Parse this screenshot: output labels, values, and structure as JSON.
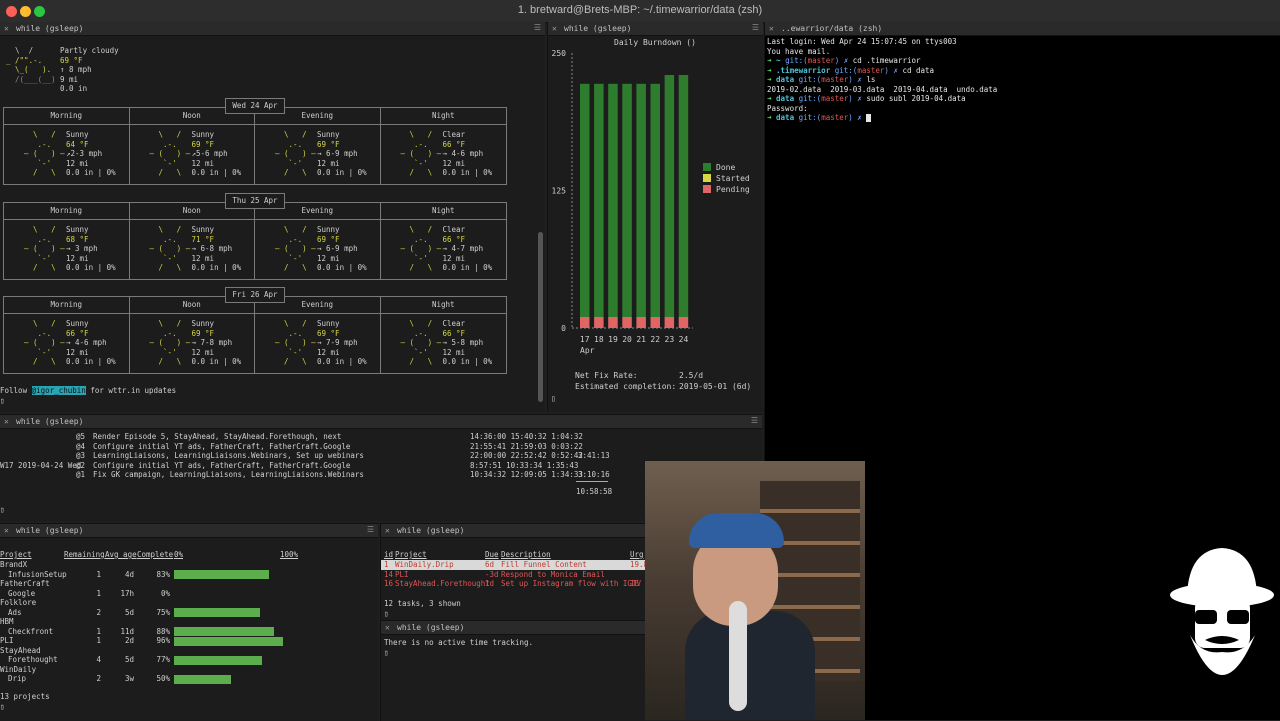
{
  "window": {
    "title": "1. bretward@Brets-MBP: ~/.timewarrior/data (zsh)"
  },
  "panes": {
    "weather": {
      "title": "while (gsleep)"
    },
    "burndown": {
      "title": "while (gsleep)"
    },
    "shell": {
      "title": "..ewarrior/data (zsh)"
    },
    "timew": {
      "title": "while (gsleep)"
    },
    "projects": {
      "title": "while (gsleep)"
    },
    "tasks": {
      "title": "while (gsleep)"
    },
    "tracking": {
      "title": "while (gsleep)"
    }
  },
  "weather": {
    "current": {
      "cond": "Partly cloudy",
      "temp": "69 °F",
      "wind": "↑ 8 mph",
      "vis": "9 mi",
      "precip": "0.0 in"
    },
    "periods": [
      "Morning",
      "Noon",
      "Evening",
      "Night"
    ],
    "days": [
      {
        "date": "Wed 24 Apr",
        "cells": [
          {
            "cond": "Sunny",
            "temp": "64 °F",
            "wind": "↗2-3 mph",
            "vis": "12 mi",
            "precip": "0.0 in | 0%"
          },
          {
            "cond": "Sunny",
            "temp": "69 °F",
            "wind": "↗5-6 mph",
            "vis": "12 mi",
            "precip": "0.0 in | 0%"
          },
          {
            "cond": "Sunny",
            "temp": "69 °F",
            "wind": "→ 6-9 mph",
            "vis": "12 mi",
            "precip": "0.0 in | 0%"
          },
          {
            "cond": "Clear",
            "temp": "66 °F",
            "wind": "→ 4-6 mph",
            "vis": "12 mi",
            "precip": "0.0 in | 0%"
          }
        ]
      },
      {
        "date": "Thu 25 Apr",
        "cells": [
          {
            "cond": "Sunny",
            "temp": "68 °F",
            "wind": "→ 3 mph",
            "vis": "12 mi",
            "precip": "0.0 in | 0%"
          },
          {
            "cond": "Sunny",
            "temp": "71 °F",
            "wind": "→ 6-8 mph",
            "vis": "12 mi",
            "precip": "0.0 in | 0%"
          },
          {
            "cond": "Sunny",
            "temp": "69 °F",
            "wind": "→ 6-9 mph",
            "vis": "12 mi",
            "precip": "0.0 in | 0%"
          },
          {
            "cond": "Clear",
            "temp": "66 °F",
            "wind": "→ 4-7 mph",
            "vis": "12 mi",
            "precip": "0.0 in | 0%"
          }
        ]
      },
      {
        "date": "Fri 26 Apr",
        "cells": [
          {
            "cond": "Sunny",
            "temp": "66 °F",
            "wind": "→ 4-6 mph",
            "vis": "12 mi",
            "precip": "0.0 in | 0%"
          },
          {
            "cond": "Sunny",
            "temp": "69 °F",
            "wind": "→ 7-8 mph",
            "vis": "12 mi",
            "precip": "0.0 in | 0%"
          },
          {
            "cond": "Sunny",
            "temp": "69 °F",
            "wind": "→ 7-9 mph",
            "vis": "12 mi",
            "precip": "0.0 in | 0%"
          },
          {
            "cond": "Clear",
            "temp": "66 °F",
            "wind": "→ 5-8 mph",
            "vis": "12 mi",
            "precip": "0.0 in | 0%"
          }
        ]
      }
    ],
    "follow": {
      "pre": "Follow",
      "handle": "@igor_chubin",
      "post": "for wttr.in updates"
    }
  },
  "burndown": {
    "title": "Daily Burndown ()",
    "y_ticks": [
      "250",
      "125",
      "0"
    ],
    "x_labels": [
      "17",
      "18",
      "19",
      "20",
      "21",
      "22",
      "23",
      "24"
    ],
    "x_month": "Apr",
    "legend": [
      {
        "label": "Done",
        "color": "#2e7d2e"
      },
      {
        "label": "Started",
        "color": "#d7d744"
      },
      {
        "label": "Pending",
        "color": "#e06666"
      }
    ],
    "net_fix_label": "Net Fix Rate:",
    "net_fix_value": "2.5/d",
    "est_label": "Estimated completion:",
    "est_value": "2019-05-01 (6d)"
  },
  "chart_data": {
    "type": "bar",
    "categories": [
      "17",
      "18",
      "19",
      "20",
      "21",
      "22",
      "23",
      "24"
    ],
    "series": [
      {
        "name": "Done",
        "values": [
          212,
          212,
          212,
          212,
          212,
          212,
          220,
          220
        ]
      },
      {
        "name": "Pending",
        "values": [
          10,
          10,
          10,
          10,
          10,
          10,
          10,
          10
        ]
      }
    ],
    "title": "Daily Burndown ()",
    "xlabel": "Apr",
    "ylabel": "",
    "ylim": [
      0,
      250
    ]
  },
  "shell": {
    "lines": [
      {
        "parts": [
          {
            "t": "Last login: Wed Apr 24 15:07:45 on ttys003",
            "c": "w"
          }
        ]
      },
      {
        "parts": [
          {
            "t": "You have mail.",
            "c": "w"
          }
        ]
      },
      {
        "parts": [
          {
            "t": "➜ ",
            "c": "g"
          },
          {
            "t": "~ ",
            "c": "cy"
          },
          {
            "t": "git:(",
            "c": "b"
          },
          {
            "t": "master",
            "c": "r"
          },
          {
            "t": ") ✗ ",
            "c": "b"
          },
          {
            "t": "cd .timewarrior",
            "c": "w"
          }
        ]
      },
      {
        "parts": [
          {
            "t": "➜ ",
            "c": "g"
          },
          {
            "t": ".timewarrior ",
            "c": "cy"
          },
          {
            "t": "git:(",
            "c": "b"
          },
          {
            "t": "master",
            "c": "r"
          },
          {
            "t": ") ✗ ",
            "c": "b"
          },
          {
            "t": "cd data",
            "c": "w"
          }
        ]
      },
      {
        "parts": [
          {
            "t": "➜ ",
            "c": "g"
          },
          {
            "t": "data ",
            "c": "cy"
          },
          {
            "t": "git:(",
            "c": "b"
          },
          {
            "t": "master",
            "c": "r"
          },
          {
            "t": ") ✗ ",
            "c": "b"
          },
          {
            "t": "ls",
            "c": "w"
          }
        ]
      },
      {
        "parts": [
          {
            "t": "2019-02.data  2019-03.data  2019-04.data  undo.data",
            "c": "w"
          }
        ]
      },
      {
        "parts": [
          {
            "t": "➜ ",
            "c": "g"
          },
          {
            "t": "data ",
            "c": "cy"
          },
          {
            "t": "git:(",
            "c": "b"
          },
          {
            "t": "master",
            "c": "r"
          },
          {
            "t": ") ✗ ",
            "c": "b"
          },
          {
            "t": "sudo subl 2019-04.data",
            "c": "w"
          }
        ]
      },
      {
        "parts": [
          {
            "t": "Password:",
            "c": "w"
          }
        ]
      },
      {
        "parts": [
          {
            "t": "➜ ",
            "c": "g"
          },
          {
            "t": "data ",
            "c": "cy"
          },
          {
            "t": "git:(",
            "c": "b"
          },
          {
            "t": "master",
            "c": "r"
          },
          {
            "t": ") ✗ ",
            "c": "b"
          }
        ]
      }
    ]
  },
  "timew": {
    "rows": [
      {
        "prefix": "",
        "id": "@5",
        "desc": "Render Episode 5, StayAhead, StayAhead.Forethough, next",
        "times": "14:36:00 15:40:32 1:04:32",
        "total": ""
      },
      {
        "prefix": "",
        "id": "@4",
        "desc": "Configure initial YT ads, FatherCraft, FatherCraft.Google",
        "times": "21:55:41 21:59:03 0:03:22",
        "total": ""
      },
      {
        "prefix": "",
        "id": "@3",
        "desc": "LearningLiaisons, LearningLiaisons.Webinars, Set up webinars",
        "times": "22:00:00 22:52:42 0:52:42",
        "total": "3:41:13"
      },
      {
        "prefix": "W17 2019-04-24 Wed",
        "id": "@2",
        "desc": "Configure initial YT ads, FatherCraft, FatherCraft.Google",
        "times": "8:57:51 10:33:34 1:35:43",
        "total": ""
      },
      {
        "prefix": "",
        "id": "@1",
        "desc": "Fix GK campaign, LearningLiaisons, LearningLiaisons.Webinars",
        "times": "10:34:32 12:09:05 1:34:33",
        "total": "3:10:16"
      }
    ],
    "grand_total": "10:58:58"
  },
  "projects": {
    "headers": [
      "Project",
      "Remaining",
      "Avg age",
      "Complete",
      "0%",
      "100%"
    ],
    "rows": [
      {
        "name": "BrandX",
        "indent": false,
        "rem": "",
        "age": "",
        "pct": "",
        "frac": 0
      },
      {
        "name": "InfusionSetup",
        "indent": true,
        "rem": "1",
        "age": "4d",
        "pct": "83%",
        "frac": 0.83
      },
      {
        "name": "FatherCraft",
        "indent": false,
        "rem": "",
        "age": "",
        "pct": "",
        "frac": 0
      },
      {
        "name": "Google",
        "indent": true,
        "rem": "1",
        "age": "17h",
        "pct": "0%",
        "frac": 0
      },
      {
        "name": "Folklore",
        "indent": false,
        "rem": "",
        "age": "",
        "pct": "",
        "frac": 0
      },
      {
        "name": "Ads",
        "indent": true,
        "rem": "2",
        "age": "5d",
        "pct": "75%",
        "frac": 0.75
      },
      {
        "name": "HBM",
        "indent": false,
        "rem": "",
        "age": "",
        "pct": "",
        "frac": 0
      },
      {
        "name": "Checkfront",
        "indent": true,
        "rem": "1",
        "age": "11d",
        "pct": "88%",
        "frac": 0.88
      },
      {
        "name": "PLI",
        "indent": false,
        "rem": "1",
        "age": "2d",
        "pct": "96%",
        "frac": 0.96
      },
      {
        "name": "StayAhead",
        "indent": false,
        "rem": "",
        "age": "",
        "pct": "",
        "frac": 0
      },
      {
        "name": "Forethought",
        "indent": true,
        "rem": "4",
        "age": "5d",
        "pct": "77%",
        "frac": 0.77
      },
      {
        "name": "WinDaily",
        "indent": false,
        "rem": "",
        "age": "",
        "pct": "",
        "frac": 0
      },
      {
        "name": "Drip",
        "indent": true,
        "rem": "2",
        "age": "3w",
        "pct": "50%",
        "frac": 0.5
      }
    ],
    "footer": "13 projects"
  },
  "tasks": {
    "headers": [
      "id",
      "Project",
      "Due",
      "Description",
      "Urg"
    ],
    "rows": [
      {
        "id": "1",
        "project": "WinDaily.Drip",
        "due": "6d",
        "desc": "Fill Funnel Content",
        "urg": "19.8",
        "style": "sel"
      },
      {
        "id": "14",
        "project": "PLI",
        "due": "-3d",
        "desc": "Respond to Monica Email",
        "urg": "",
        "style": "red"
      },
      {
        "id": "16",
        "project": "StayAhead.Forethought",
        "due": "1d",
        "desc": "Set up Instagram flow with IGTV",
        "urg": "1E",
        "style": "red"
      }
    ],
    "footer": "12 tasks, 3 shown"
  },
  "tracking": {
    "message": "There is no active time tracking."
  }
}
